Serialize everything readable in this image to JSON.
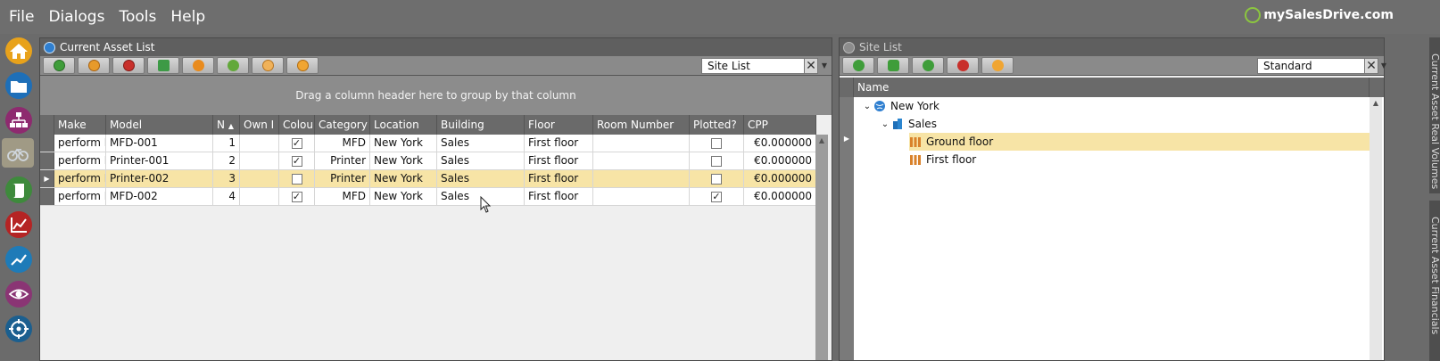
{
  "menu": [
    "File",
    "Dialogs",
    "Tools",
    "Help"
  ],
  "brand": "mySalesDrive.com",
  "rail_icons": [
    "home-icon",
    "folder-icon",
    "hierarchy-icon",
    "bicycle-icon",
    "scroll-icon",
    "chart-icon",
    "trend-icon",
    "eye-icon",
    "target-icon"
  ],
  "asset_panel": {
    "title": "Current Asset List",
    "toolbar_icons": [
      "add-icon",
      "refresh-icon",
      "remove-icon",
      "swap-icon",
      "gear-icon",
      "pencil-icon",
      "target-icon",
      "sync-icon"
    ],
    "view_selector": "Site List",
    "group_hint": "Drag a column header here to group by that column",
    "columns": [
      "Make",
      "Model",
      "N",
      "Own I",
      "Colou",
      "Category",
      "Location",
      "Building",
      "Floor",
      "Room Number",
      "Plotted?",
      "CPP"
    ],
    "rows": [
      {
        "make": "perform I",
        "model": "MFD-001",
        "n": "1",
        "own": "",
        "colour": true,
        "category": "MFD",
        "location": "New York",
        "building": "Sales",
        "floor": "First floor",
        "room": "",
        "plotted": false,
        "cpp": "€0.000000"
      },
      {
        "make": "perform I",
        "model": "Printer-001",
        "n": "2",
        "own": "",
        "colour": true,
        "category": "Printer",
        "location": "New York",
        "building": "Sales",
        "floor": "First floor",
        "room": "",
        "plotted": false,
        "cpp": "€0.000000"
      },
      {
        "make": "perform I",
        "model": "Printer-002",
        "n": "3",
        "own": "",
        "colour": false,
        "category": "Printer",
        "location": "New York",
        "building": "Sales",
        "floor": "First floor",
        "room": "",
        "plotted": false,
        "cpp": "€0.000000"
      },
      {
        "make": "perform I",
        "model": "MFD-002",
        "n": "4",
        "own": "",
        "colour": true,
        "category": "MFD",
        "location": "New York",
        "building": "Sales",
        "floor": "First floor",
        "room": "",
        "plotted": true,
        "cpp": "€0.000000"
      }
    ]
  },
  "site_panel": {
    "title": "Site List",
    "toolbar_icons": [
      "globe-icon",
      "building-icon",
      "floor-icon",
      "remove-icon",
      "sync-icon"
    ],
    "view_selector": "Standard",
    "column": "Name",
    "tree": [
      {
        "label": "New York",
        "icon": "globe-icon",
        "expanded": true
      },
      {
        "label": "Sales",
        "icon": "building-icon",
        "expanded": true
      },
      {
        "label": "Ground floor",
        "icon": "floor-icon"
      },
      {
        "label": "First floor",
        "icon": "floor-icon"
      }
    ]
  },
  "side_tabs": [
    "Current Asset Real Volumes",
    "Current Asset Financials"
  ]
}
